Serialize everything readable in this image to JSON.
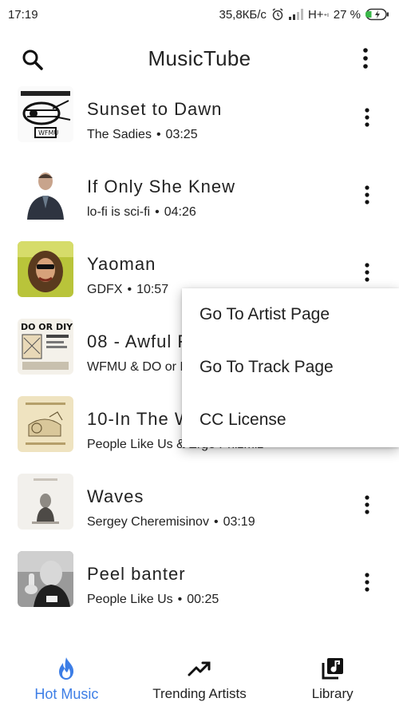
{
  "status_bar": {
    "time": "17:19",
    "speed": "35,8КБ/с",
    "network": "H+",
    "network_sub": "⁺ᴵ",
    "battery": "27 %"
  },
  "app_bar": {
    "title": "MusicTube"
  },
  "tracks": [
    {
      "title": "Sunset to Dawn",
      "artist": "The Sadies",
      "duration": "03:25",
      "thumb": "art-three-chord-monte"
    },
    {
      "title": "If Only She Knew",
      "artist": "lo-fi is sci-fi",
      "duration": "04:26",
      "thumb": "man-portrait"
    },
    {
      "title": "Yaoman",
      "artist": "GDFX",
      "duration": "10:57",
      "thumb": "bearded-man-yellow"
    },
    {
      "title": "08 - Awful F",
      "artist": "WFMU & DO or D",
      "duration": "",
      "thumb": "do-or-diy-cover"
    },
    {
      "title": "10-In The W",
      "artist": "People Like Us & Ergo Phizmiz",
      "duration": "",
      "thumb": "rhapsody-in-glue-cover"
    },
    {
      "title": "Waves",
      "artist": "Sergey Cheremisinov",
      "duration": "03:19",
      "thumb": "waves-cover"
    },
    {
      "title": "Peel banter",
      "artist": "People Like Us",
      "duration": "00:25",
      "thumb": "peel-banter-photo"
    }
  ],
  "popup_menu": {
    "items": [
      "Go To Artist Page",
      "Go To Track Page",
      "CC License"
    ]
  },
  "bottom_nav": {
    "items": [
      {
        "label": "Hot Music",
        "icon": "flame-icon",
        "active": true
      },
      {
        "label": "Trending Artists",
        "icon": "trending-up-icon",
        "active": false
      },
      {
        "label": "Library",
        "icon": "library-music-icon",
        "active": false
      }
    ]
  },
  "colors": {
    "accent": "#3d7ee6",
    "text": "#212121"
  }
}
